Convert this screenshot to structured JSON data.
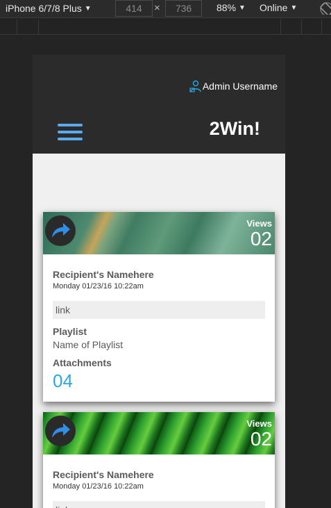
{
  "devtools": {
    "device": "iPhone 6/7/8 Plus",
    "width": "414",
    "height": "736",
    "zoom": "88%",
    "network": "Online"
  },
  "header": {
    "admin_name": "Admin Username",
    "brand": "2Win!",
    "menu_color": "#5aaaf0"
  },
  "cards": [
    {
      "views_label": "Views",
      "views_count": "02",
      "recipient": "Recipient's Namehere",
      "datetime": "Monday 01/23/16 10:22am",
      "link": "link",
      "playlist_label": "Playlist",
      "playlist_name": "Name of Playlist",
      "attachments_label": "Attachments",
      "attachments_count": "04"
    },
    {
      "views_label": "Views",
      "views_count": "02",
      "recipient": "Recipient's Namehere",
      "datetime": "Monday 01/23/16 10:22am",
      "link": "link"
    }
  ],
  "colors": {
    "accent": "#29a8e0",
    "share_icon": "#2f8fe8"
  }
}
